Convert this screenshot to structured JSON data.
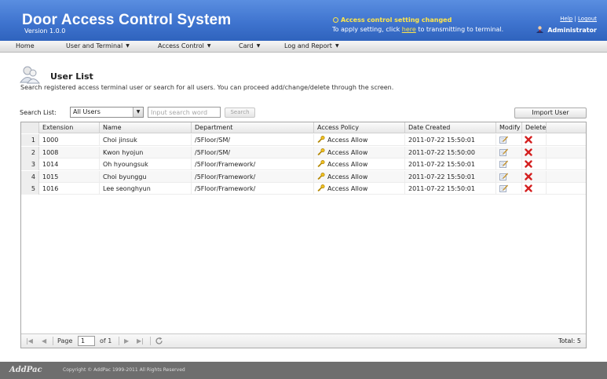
{
  "header": {
    "title": "Door Access Control System",
    "version": "Version 1.0.0",
    "notice_title": "Access control setting changed",
    "notice_pre": "To apply setting, click ",
    "notice_link": "here",
    "notice_post": " to transmitting to terminal.",
    "help_link": "Help",
    "logout_link": "Logout",
    "user": "Administrator"
  },
  "menu": [
    {
      "label": "Home",
      "has_dropdown": false
    },
    {
      "label": "User and Terminal",
      "has_dropdown": true
    },
    {
      "label": "Access Control",
      "has_dropdown": true
    },
    {
      "label": "Card",
      "has_dropdown": true
    },
    {
      "label": "Log and Report",
      "has_dropdown": true
    }
  ],
  "page": {
    "title": "User List",
    "description": "Search registered access terminal user or search for all users. You can proceed add/change/delete through the screen."
  },
  "search": {
    "label": "Search List:",
    "selected": "All Users",
    "placeholder": "Input search word",
    "button": "Search",
    "import_button": "Import User"
  },
  "table": {
    "columns": [
      "Extension",
      "Name",
      "Department",
      "Access Policy",
      "Date Created",
      "Modify",
      "Delete"
    ],
    "rows": [
      {
        "num": "1",
        "extension": "1000",
        "name": "Choi jinsuk",
        "department": "/5Floor/SM/",
        "policy": "Access Allow",
        "created": "2011-07-22 15:50:01"
      },
      {
        "num": "2",
        "extension": "1008",
        "name": "Kwon hyojun",
        "department": "/5Floor/SM/",
        "policy": "Access Allow",
        "created": "2011-07-22 15:50:00"
      },
      {
        "num": "3",
        "extension": "1014",
        "name": "Oh hyoungsuk",
        "department": "/5Floor/Framework/",
        "policy": "Access Allow",
        "created": "2011-07-22 15:50:01"
      },
      {
        "num": "4",
        "extension": "1015",
        "name": "Choi byunggu",
        "department": "/5Floor/Framework/",
        "policy": "Access Allow",
        "created": "2011-07-22 15:50:01"
      },
      {
        "num": "5",
        "extension": "1016",
        "name": "Lee seonghyun",
        "department": "/5Floor/Framework/",
        "policy": "Access Allow",
        "created": "2011-07-22 15:50:01"
      }
    ]
  },
  "pager": {
    "page_label": "Page",
    "page_value": "1",
    "of_label": "of 1",
    "total": "Total: 5"
  },
  "footer": {
    "logo": "AddPac",
    "copyright": "Copyright © AddPac 1999-2011 All Rights Reserved"
  },
  "colors": {
    "header_blue": "#3f74cf",
    "notice_yellow": "#ffe64a",
    "delete_red": "#d42020",
    "footer_gray": "#6e6e6e"
  },
  "icons": {
    "policy": "key-icon",
    "modify": "edit-icon",
    "delete": "delete-x-icon"
  }
}
